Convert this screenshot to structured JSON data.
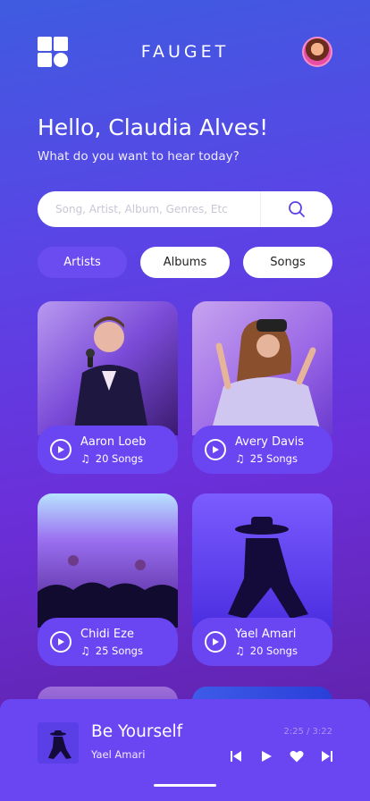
{
  "header": {
    "brand": "FAUGET"
  },
  "greeting": {
    "title": "Hello, Claudia Alves!",
    "subtitle": "What do you want to hear today?"
  },
  "search": {
    "placeholder": "Song, Artist, Album, Genres, Etc",
    "value": ""
  },
  "tabs": [
    {
      "label": "Artists",
      "active": true
    },
    {
      "label": "Albums",
      "active": false
    },
    {
      "label": "Songs",
      "active": false
    }
  ],
  "artists": [
    {
      "name": "Aaron Loeb",
      "songs": "20 Songs"
    },
    {
      "name": "Avery Davis",
      "songs": "25 Songs"
    },
    {
      "name": "Chidi Eze",
      "songs": "25 Songs"
    },
    {
      "name": "Yael Amari",
      "songs": "20 Songs"
    }
  ],
  "now_playing": {
    "title": "Be Yourself",
    "artist": "Yael Amari",
    "time": "2:25 / 3:22"
  },
  "colors": {
    "accent": "#6a45f2",
    "background_top": "#3f5be0",
    "background_bottom": "#5d1f9e"
  },
  "icons": [
    "app-grid-icon",
    "search-icon",
    "play-icon",
    "music-note-icon",
    "previous-icon",
    "play-icon",
    "heart-icon",
    "next-icon"
  ]
}
